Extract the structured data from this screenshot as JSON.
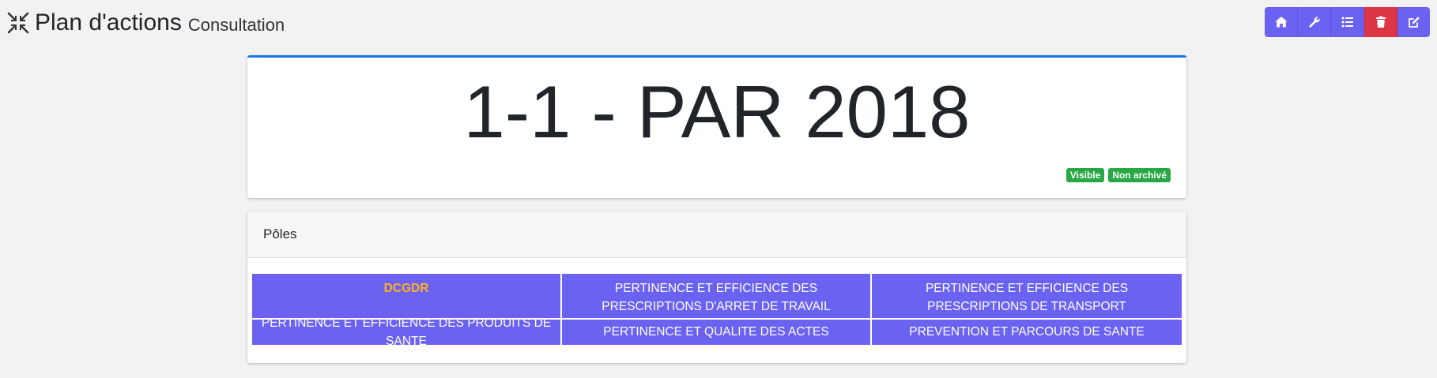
{
  "header": {
    "title": "Plan d'actions",
    "subtitle": "Consultation",
    "icon": "compress-icon"
  },
  "toolbar": {
    "buttons": [
      {
        "name": "home-icon",
        "color": "#6b62f2"
      },
      {
        "name": "wrench-icon",
        "color": "#6b62f2"
      },
      {
        "name": "list-icon",
        "color": "#6b62f2"
      },
      {
        "name": "trash-icon",
        "color": "#dc3545"
      },
      {
        "name": "edit-icon",
        "color": "#6b62f2"
      }
    ]
  },
  "plan": {
    "title": "1-1 - PAR 2018",
    "badges": {
      "visible": "Visible",
      "archive": "Non archivé"
    }
  },
  "poles": {
    "header": "Pôles",
    "items": [
      "DCGDR",
      "PERTINENCE ET EFFICIENCE DES PRESCRIPTIONS D'ARRET DE TRAVAIL",
      "PERTINENCE ET EFFICIENCE DES PRESCRIPTIONS DE TRANSPORT",
      "PERTINENCE ET EFFICIENCE DES PRODUITS DE SANTE",
      "PERTINENCE ET QUALITE DES ACTES",
      "PREVENTION ET PARCOURS DE SANTE"
    ]
  },
  "colors": {
    "accent": "#6b62f2",
    "danger": "#dc3545",
    "success": "#28a745",
    "card_border": "#1a73e8",
    "highlight_text": "#ffb020"
  }
}
